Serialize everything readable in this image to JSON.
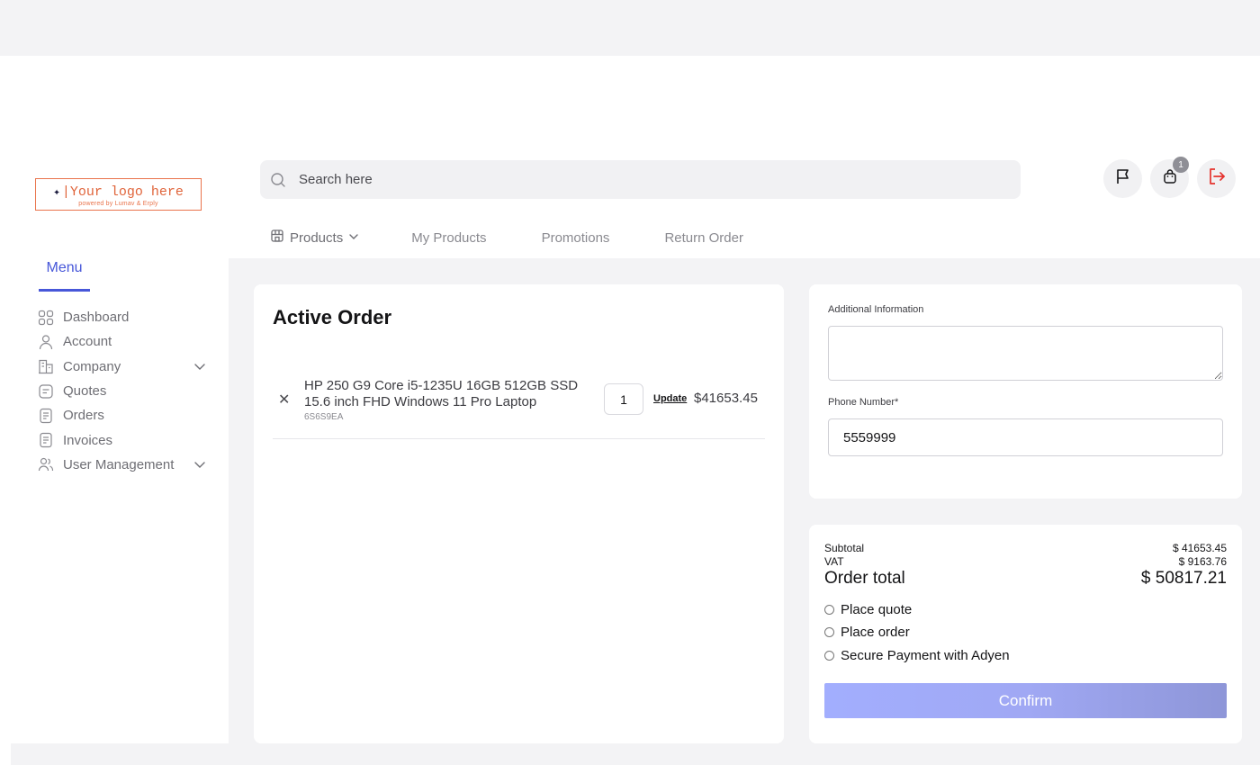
{
  "logo": {
    "text": "|Your logo here",
    "mark": "✦",
    "powered_by": "powered by Lumav & Erply"
  },
  "search": {
    "placeholder": "Search here"
  },
  "header_actions": {
    "cart_count": "1"
  },
  "topnav": {
    "items": [
      "Products",
      "My Products",
      "Promotions",
      "Return Order"
    ]
  },
  "sidebar": {
    "menu_tab": "Menu",
    "items": [
      "Dashboard",
      "Account",
      "Company",
      "Quotes",
      "Orders",
      "Invoices",
      "User Management"
    ]
  },
  "order": {
    "title": "Active Order",
    "line": {
      "name": "HP 250 G9 Core i5-1235U 16GB 512GB SSD 15.6 inch FHD Windows 11 Pro Laptop",
      "sku": "6S6S9EA",
      "quantity": "1",
      "update_label": "Update",
      "price": "$41653.45"
    }
  },
  "form": {
    "additional_label": "Additional Information",
    "phone_label": "Phone Number*",
    "phone_value": "5559999"
  },
  "summary": {
    "subtotal_label": "Subtotal",
    "subtotal": "$ 41653.45",
    "vat_label": "VAT",
    "vat": "$ 9163.76",
    "total_label": "Order total",
    "total": "$ 50817.21",
    "options": [
      "Place quote",
      "Place order",
      "Secure Payment with Adyen"
    ],
    "confirm_label": "Confirm"
  },
  "colors": {
    "accent": "#4757d9",
    "logo": "#e9744c",
    "logout": "#e5322d",
    "confirm_start": "#a2aefe",
    "confirm_end": "#8e96d8"
  }
}
